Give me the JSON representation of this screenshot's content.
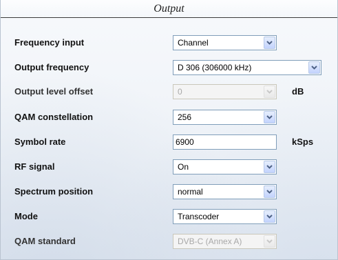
{
  "panel": {
    "title": "Output"
  },
  "rows": {
    "frequency_input": {
      "label": "Frequency input",
      "value": "Channel"
    },
    "output_frequency": {
      "label": "Output frequency",
      "value": "D 306 (306000 kHz)"
    },
    "output_level_offset": {
      "label": "Output level offset",
      "value": "0",
      "unit": "dB"
    },
    "qam_constellation": {
      "label": "QAM constellation",
      "value": "256"
    },
    "symbol_rate": {
      "label": "Symbol rate",
      "value": "6900",
      "unit": "kSps"
    },
    "rf_signal": {
      "label": "RF signal",
      "value": "On"
    },
    "spectrum_position": {
      "label": "Spectrum position",
      "value": "normal"
    },
    "mode": {
      "label": "Mode",
      "value": "Transcoder"
    },
    "qam_standard": {
      "label": "QAM standard",
      "value": "DVB-C (Annex A)"
    }
  },
  "icons": {
    "dropdown_arrow": "chevron-down-icon"
  },
  "colors": {
    "field_border": "#7f9db9",
    "arrow_button": "#c3d3fd",
    "arrow_glyph": "#4d6185",
    "disabled_text": "#a8a8a8"
  }
}
